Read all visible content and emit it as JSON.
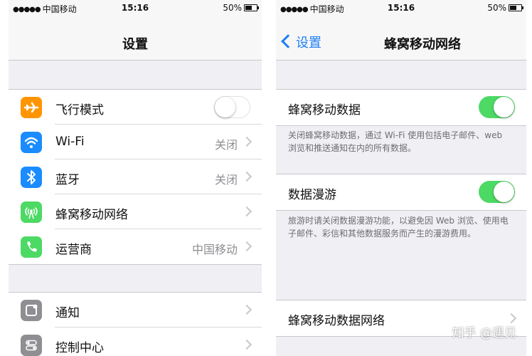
{
  "status_bar": {
    "signal_dots": "●●●●●",
    "carrier": "中国移动",
    "time": "15:16",
    "battery": "50%",
    "battery_level": 0.5
  },
  "settings_screen": {
    "title": "设置",
    "rows": [
      {
        "label": "飞行模式",
        "icon": "airplane-icon",
        "icon_color": "#ff9500",
        "toggle_on": false
      },
      {
        "label": "Wi-Fi",
        "icon": "wifi-icon",
        "icon_color": "#1a8cff",
        "value": "关闭"
      },
      {
        "label": "蓝牙",
        "icon": "bluetooth-icon",
        "icon_color": "#1a8cff",
        "value": "关闭"
      },
      {
        "label": "蜂窝移动网络",
        "icon": "cellular-antenna-icon",
        "icon_color": "#4cd964"
      },
      {
        "label": "运营商",
        "icon": "phone-icon",
        "icon_color": "#4cd964",
        "value": "中国移动"
      },
      {
        "label": "通知",
        "icon": "notifications-icon",
        "icon_color": "#8e8e93"
      },
      {
        "label": "控制中心",
        "icon": "control-center-icon",
        "icon_color": "#8e8e93"
      }
    ]
  },
  "cellular_screen": {
    "back_label": "设置",
    "title": "蜂窝移动网络",
    "cellular_data": {
      "label": "蜂窝移动数据",
      "toggle_on": true
    },
    "cellular_data_note": "关闭蜂窝移动数据，通过 Wi-Fi 使用包括电子邮件、web 浏览和推送通知在内的所有数据。",
    "data_roaming": {
      "label": "数据漫游",
      "toggle_on": true
    },
    "data_roaming_note": "旅游时请关闭数据漫游功能，以避免因 Web 浏览、使用电子邮件、彩信和其他数据服务而产生的漫游费用。",
    "cellular_data_network": {
      "label": "蜂窝移动数据网络"
    }
  },
  "watermark": "知乎 @遇见",
  "colors": {
    "accent_blue": "#1e7ef5",
    "toggle_green": "#4cd964",
    "background": "#efeff4"
  }
}
